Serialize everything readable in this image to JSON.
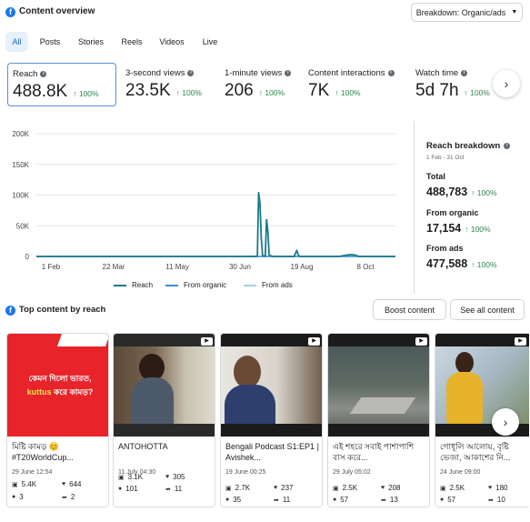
{
  "header": {
    "title": "Content overview",
    "breakdown_dropdown": "Breakdown: Organic/ads"
  },
  "tabs": [
    {
      "label": "All",
      "active": true
    },
    {
      "label": "Posts",
      "active": false
    },
    {
      "label": "Stories",
      "active": false
    },
    {
      "label": "Reels",
      "active": false
    },
    {
      "label": "Videos",
      "active": false
    },
    {
      "label": "Live",
      "active": false
    }
  ],
  "metrics": [
    {
      "label": "Reach",
      "value": "488.8K",
      "change": "↑ 100%",
      "selected": true
    },
    {
      "label": "3-second views",
      "value": "23.5K",
      "change": "↑ 100%"
    },
    {
      "label": "1-minute views",
      "value": "206",
      "change": "↑ 100%"
    },
    {
      "label": "Content interactions",
      "value": "7K",
      "change": "↑ 100%"
    },
    {
      "label": "Watch time",
      "value": "5d 7h",
      "change": "↑ 100%"
    }
  ],
  "chart_data": {
    "type": "line",
    "title": "",
    "x_tick_labels": [
      "1 Feb",
      "22 Mar",
      "11 May",
      "30 Jun",
      "19 Aug",
      "8 Oct"
    ],
    "y_tick_labels": [
      "0",
      "50K",
      "100K",
      "150K",
      "200K"
    ],
    "ylim": [
      0,
      200000
    ],
    "x_range_days": [
      0,
      273
    ],
    "grid": true,
    "legend_placement": "bottom",
    "series": [
      {
        "name": "Reach",
        "color": "#1a7a8c",
        "points": [
          [
            0,
            0
          ],
          [
            60,
            0
          ],
          [
            120,
            0
          ],
          [
            160,
            0
          ],
          [
            168,
            300
          ],
          [
            169,
            104000
          ],
          [
            170,
            86000
          ],
          [
            171,
            30000
          ],
          [
            172,
            1000
          ],
          [
            174,
            500
          ],
          [
            175,
            60000
          ],
          [
            176,
            40000
          ],
          [
            177,
            2000
          ],
          [
            180,
            0
          ],
          [
            196,
            0
          ],
          [
            197,
            5000
          ],
          [
            198,
            10000
          ],
          [
            199,
            3000
          ],
          [
            200,
            0
          ],
          [
            230,
            0
          ],
          [
            235,
            2000
          ],
          [
            239,
            3000
          ],
          [
            242,
            2500
          ],
          [
            245,
            0
          ],
          [
            273,
            0
          ]
        ]
      },
      {
        "name": "From organic",
        "color": "#3b8fd6",
        "points": [
          [
            0,
            0
          ],
          [
            273,
            0
          ]
        ]
      },
      {
        "name": "From ads",
        "color": "#9fd4ea",
        "points": [
          [
            0,
            0
          ],
          [
            273,
            0
          ]
        ]
      }
    ]
  },
  "breakdown": {
    "title": "Reach breakdown",
    "date_range": "1 Feb - 31 Oct",
    "rows": [
      {
        "label": "Total",
        "value": "488,783",
        "change": "↑ 100%"
      },
      {
        "label": "From organic",
        "value": "17,154",
        "change": "↑ 100%"
      },
      {
        "label": "From ads",
        "value": "477,588",
        "change": "↑ 100%"
      }
    ]
  },
  "top_content": {
    "title": "Top content by reach",
    "boost_label": "Boost content",
    "see_all_label": "See all content",
    "cards": [
      {
        "title": "মিষ্টি কামড় 😊 #T20WorldCup...",
        "date": "29 June 12:54",
        "reach": "5.4K",
        "likes": "644",
        "comments": "3",
        "shares": "2",
        "thumb_text_line1": "কেমন দিলো ভারত,",
        "thumb_text_kuttus": "kuttus",
        "thumb_text_line2": " করে কামড়?"
      },
      {
        "title": "ANTOHOTTA",
        "date": "11 July 04:30",
        "reach": "3.1K",
        "likes": "305",
        "comments": "101",
        "shares": "11"
      },
      {
        "title": "Bengali Podcast S1:EP1 | Avishek...",
        "date": "19 June 00:25",
        "reach": "2.7K",
        "likes": "237",
        "comments": "35",
        "shares": "11"
      },
      {
        "title": "এই শহরে সবাই পাশাপাশি বাস করে...",
        "date": "29 July 05:02",
        "reach": "2.5K",
        "likes": "208",
        "comments": "57",
        "shares": "13"
      },
      {
        "title": "গোধূলি আলোয়, বৃষ্টি ভেজা, আকাশের নি...",
        "date": "24 June 09:00",
        "reach": "2.5K",
        "likes": "180",
        "comments": "57",
        "shares": "10"
      }
    ]
  }
}
